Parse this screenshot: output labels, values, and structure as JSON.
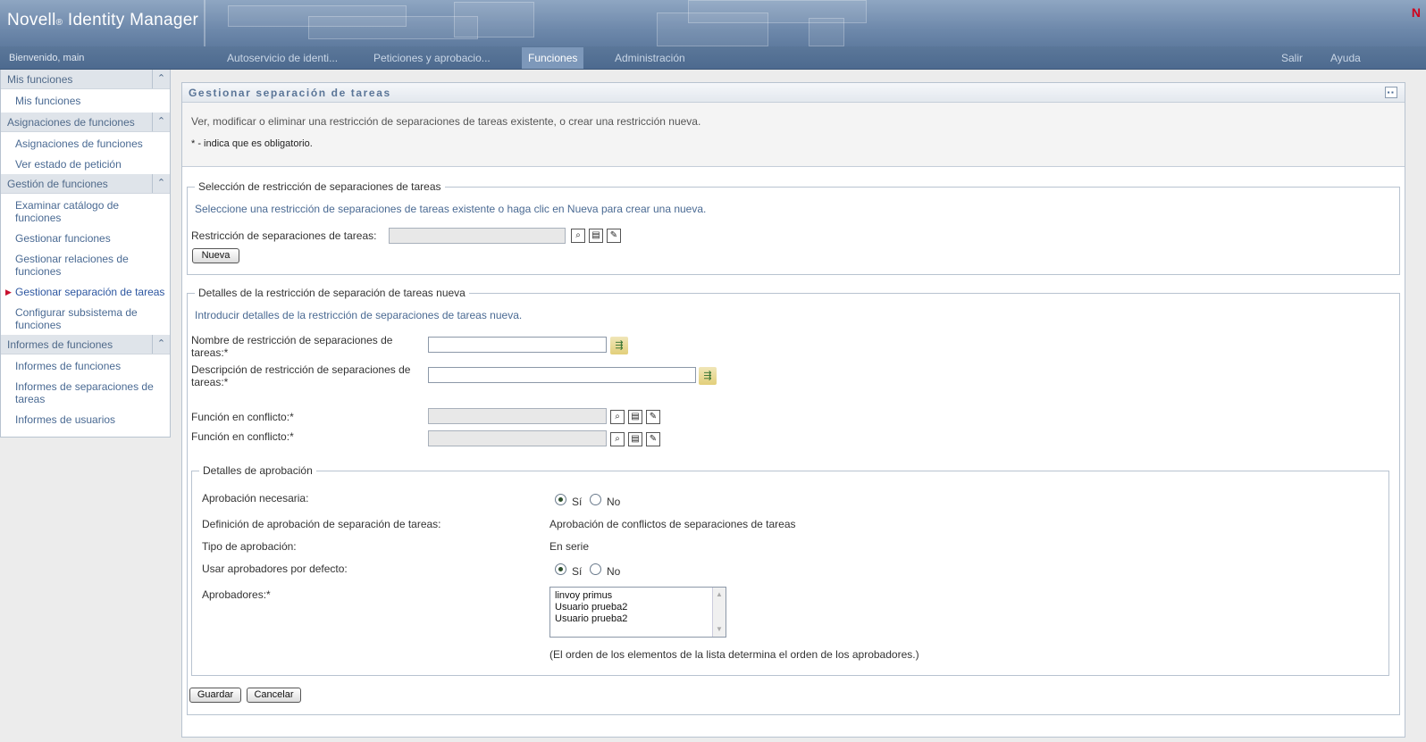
{
  "header": {
    "brand": "Novell",
    "brand_reg": "®",
    "product": " Identity Manager",
    "logo_letter": "N",
    "welcome": "Bienvenido, main",
    "tabs": [
      {
        "label": "Autoservicio de identi..."
      },
      {
        "label": "Peticiones y aprobacio..."
      },
      {
        "label": "Funciones"
      },
      {
        "label": "Administración"
      }
    ],
    "right_links": {
      "logout": "Salir",
      "help": "Ayuda"
    }
  },
  "sidebar": {
    "sections": [
      {
        "title": "Mis funciones",
        "items": [
          "Mis funciones"
        ]
      },
      {
        "title": "Asignaciones de funciones",
        "items": [
          "Asignaciones de funciones",
          "Ver estado de petición"
        ]
      },
      {
        "title": "Gestión de funciones",
        "items": [
          "Examinar catálogo de funciones",
          "Gestionar funciones",
          "Gestionar relaciones de funciones",
          "Gestionar separación de tareas",
          "Configurar subsistema de funciones"
        ]
      },
      {
        "title": "Informes de funciones",
        "items": [
          "Informes de funciones",
          "Informes de separaciones de tareas",
          "Informes de usuarios"
        ]
      }
    ]
  },
  "page": {
    "title": "Gestionar separación de tareas",
    "description": "Ver, modificar o eliminar una restricción de separaciones de tareas existente, o crear una restricción nueva.",
    "required_note": "* - indica que es obligatorio."
  },
  "selection": {
    "legend": "Selección de restricción de separaciones de tareas",
    "hint": "Seleccione una restricción de separaciones de tareas existente o haga clic en Nueva para crear una nueva.",
    "field_label": "Restricción de separaciones de tareas:",
    "new_button": "Nueva"
  },
  "details": {
    "legend": "Detalles de la restricción de separación de tareas nueva",
    "hint": "Introducir detalles de la restricción de separaciones de tareas nueva.",
    "name_label": "Nombre de restricción de separaciones de tareas:*",
    "desc_label": "Descripción de restricción de separaciones de tareas:*",
    "conflict1_label": "Función en conflicto:*",
    "conflict2_label": "Función en conflicto:*"
  },
  "approval": {
    "legend": "Detalles de aprobación",
    "required_label": "Aprobación necesaria:",
    "yes": "Sí",
    "no": "No",
    "definition_label": "Definición de aprobación de separación de tareas:",
    "definition_value": "Aprobación de conflictos de separaciones de tareas",
    "type_label": "Tipo de aprobación:",
    "type_value": "En serie",
    "default_label": "Usar aprobadores por defecto:",
    "approvers_label": "Aprobadores:*",
    "approvers": [
      "linvoy primus",
      "Usuario prueba2",
      "Usuario prueba2"
    ],
    "order_note": "(El orden de los elementos de la lista determina el orden de los aprobadores.)"
  },
  "actions": {
    "save": "Guardar",
    "cancel": "Cancelar"
  },
  "icons": {
    "lookup": "search-icon",
    "history": "history-icon",
    "reset": "reset-icon",
    "localize": "localize-icon"
  }
}
